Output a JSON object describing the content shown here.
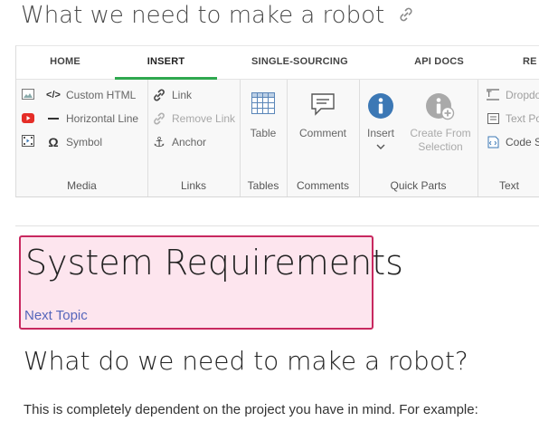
{
  "page": {
    "title": "What we need to make a robot"
  },
  "ribbon": {
    "tabs": [
      {
        "label": "HOME",
        "active": false
      },
      {
        "label": "INSERT",
        "active": true
      },
      {
        "label": "SINGLE-SOURCING",
        "active": false
      },
      {
        "label": "API DOCS",
        "active": false
      },
      {
        "label": "RE",
        "active": false
      }
    ],
    "groups": {
      "media": {
        "label": "Media",
        "items": [
          {
            "label": "Custom HTML",
            "icon": "code-icon"
          },
          {
            "label": "Horizontal Line",
            "icon": "horizontal-line-icon"
          },
          {
            "label": "Symbol",
            "icon": "omega-icon"
          }
        ],
        "icons": [
          "image-icon",
          "youtube-icon",
          "video-icon"
        ]
      },
      "links": {
        "label": "Links",
        "items": [
          {
            "label": "Link",
            "icon": "link-icon",
            "enabled": true
          },
          {
            "label": "Remove Link",
            "icon": "unlink-icon",
            "enabled": false
          },
          {
            "label": "Anchor",
            "icon": "anchor-icon",
            "enabled": true
          }
        ]
      },
      "tables": {
        "label": "Tables",
        "button": "Table"
      },
      "comments": {
        "label": "Comments",
        "button": "Comment"
      },
      "quick_parts": {
        "label": "Quick Parts",
        "insert": "Insert",
        "create_line1": "Create From",
        "create_line2": "Selection"
      },
      "text": {
        "label": "Text",
        "items": [
          "Dropdo",
          "Text Po",
          "Code S"
        ]
      }
    }
  },
  "content": {
    "topic_title": "System Requirements",
    "next_topic": "Next Topic",
    "heading": "What do we need to make a robot?",
    "paragraph": "This is completely dependent on the project you have in mind. For example:"
  },
  "colors": {
    "accent_tab": "#2fa84f",
    "topic_border": "#c8285f",
    "topic_bg": "#fde5ee",
    "link": "#5566bb",
    "info_blue": "#3c78b5"
  }
}
